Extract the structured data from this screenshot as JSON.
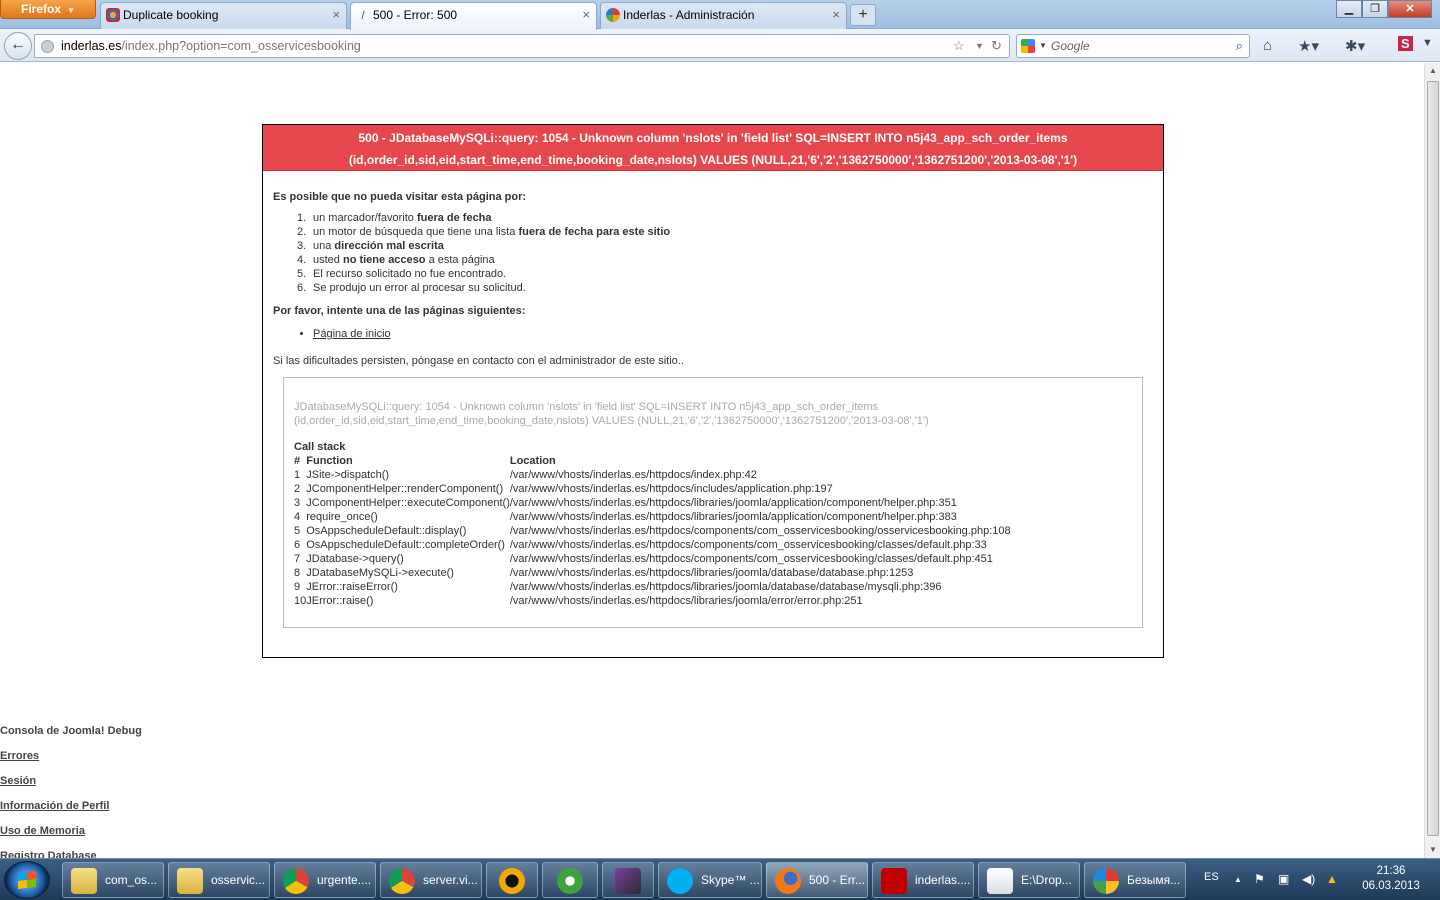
{
  "browser": {
    "app_button": "Firefox",
    "tabs": [
      {
        "title": "Duplicate booking",
        "active": false
      },
      {
        "title": "500 - Error: 500",
        "active": true
      },
      {
        "title": "Inderlas - Administración",
        "active": false
      }
    ],
    "url_domain": "inderlas.es",
    "url_path": "/index.php?option=com_osservicesbooking",
    "search_placeholder": "Google"
  },
  "error": {
    "header_line1": "500 - JDatabaseMySQLi::query: 1054 - Unknown column 'nslots' in 'field list' SQL=INSERT INTO n5j43_app_sch_order_items",
    "header_line2": "(id,order_id,sid,eid,start_time,end_time,booking_date,nslots) VALUES (NULL,21,'6','2','1362750000','1362751200','2013-03-08','1')",
    "lead": "Es posible que no pueda visitar esta página por:",
    "reasons": [
      {
        "num": "1.",
        "pre": "un marcador/favorito ",
        "bold": "fuera de fecha",
        "post": ""
      },
      {
        "num": "2.",
        "pre": "un motor de búsqueda que tiene una lista ",
        "bold": "fuera de fecha para este sitio",
        "post": ""
      },
      {
        "num": "3.",
        "pre": "una ",
        "bold": "dirección mal escrita",
        "post": ""
      },
      {
        "num": "4.",
        "pre": "usted ",
        "bold": "no tiene acceso",
        "post": " a esta página"
      },
      {
        "num": "5.",
        "pre": "El recurso solicitado no fue encontrado.",
        "bold": "",
        "post": ""
      },
      {
        "num": "6.",
        "pre": "Se produjo un error al procesar su solicitud.",
        "bold": "",
        "post": ""
      }
    ],
    "try_pages": "Por favor, intente una de las páginas siguientes:",
    "home_link": "Página de inicio",
    "contact": "Si las dificultades persisten, póngase en contacto con el administrador de este sitio..",
    "stack_msg_line1": "JDatabaseMySQLi::query: 1054 - Unknown column 'nslots' in 'field list' SQL=INSERT INTO n5j43_app_sch_order_items",
    "stack_msg_line2": "(id,order_id,sid,eid,start_time,end_time,booking_date,nslots) VALUES (NULL,21,'6','2','1362750000','1362751200','2013-03-08','1')",
    "call_stack_title": "Call stack",
    "stack_headers": [
      "#",
      "Function",
      "Location"
    ],
    "stack_rows": [
      [
        "1",
        "JSite->dispatch()",
        "/var/www/vhosts/inderlas.es/httpdocs/index.php:42"
      ],
      [
        "2",
        "JComponentHelper::renderComponent()",
        "/var/www/vhosts/inderlas.es/httpdocs/includes/application.php:197"
      ],
      [
        "3",
        "JComponentHelper::executeComponent()",
        "/var/www/vhosts/inderlas.es/httpdocs/libraries/joomla/application/component/helper.php:351"
      ],
      [
        "4",
        "require_once()",
        "/var/www/vhosts/inderlas.es/httpdocs/libraries/joomla/application/component/helper.php:383"
      ],
      [
        "5",
        "OsAppscheduleDefault::display()",
        "/var/www/vhosts/inderlas.es/httpdocs/components/com_osservicesbooking/osservicesbooking.php:108"
      ],
      [
        "6",
        "OsAppscheduleDefault::completeOrder()",
        "/var/www/vhosts/inderlas.es/httpdocs/components/com_osservicesbooking/classes/default.php:33"
      ],
      [
        "7",
        "JDatabase->query()",
        "/var/www/vhosts/inderlas.es/httpdocs/components/com_osservicesbooking/classes/default.php:451"
      ],
      [
        "8",
        "JDatabaseMySQLi->execute()",
        "/var/www/vhosts/inderlas.es/httpdocs/libraries/joomla/database/database.php:1253"
      ],
      [
        "9",
        "JError::raiseError()",
        "/var/www/vhosts/inderlas.es/httpdocs/libraries/joomla/database/database/mysqli.php:396"
      ],
      [
        "10",
        "JError::raise()",
        "/var/www/vhosts/inderlas.es/httpdocs/libraries/joomla/error/error.php:251"
      ]
    ]
  },
  "debug": {
    "title": "Consola de Joomla! Debug",
    "items": [
      "Errores",
      "Sesión",
      "Información de Perfil",
      "Uso de Memoria",
      "Registro Database"
    ]
  },
  "taskbar": {
    "items": [
      {
        "label": "com_os...",
        "icon": "folder-icon"
      },
      {
        "label": "osservic...",
        "icon": "folder-icon"
      },
      {
        "label": "urgente....",
        "icon": "chrome-icon"
      },
      {
        "label": "server.vi...",
        "icon": "chrome-icon"
      },
      {
        "label": "",
        "icon": "aimp-icon"
      },
      {
        "label": "",
        "icon": "utorrent-icon"
      },
      {
        "label": "",
        "icon": "video-converter-icon"
      },
      {
        "label": "Skype™ ...",
        "icon": "skype-icon"
      },
      {
        "label": "500 - Err...",
        "icon": "firefox-icon"
      },
      {
        "label": "inderlas....",
        "icon": "filezilla-icon"
      },
      {
        "label": "E:\\Drop...",
        "icon": "notepad-icon"
      },
      {
        "label": "Безымя...",
        "icon": "paint-icon"
      }
    ],
    "language": "ES",
    "time": "21:36",
    "date": "06.03.2013"
  }
}
